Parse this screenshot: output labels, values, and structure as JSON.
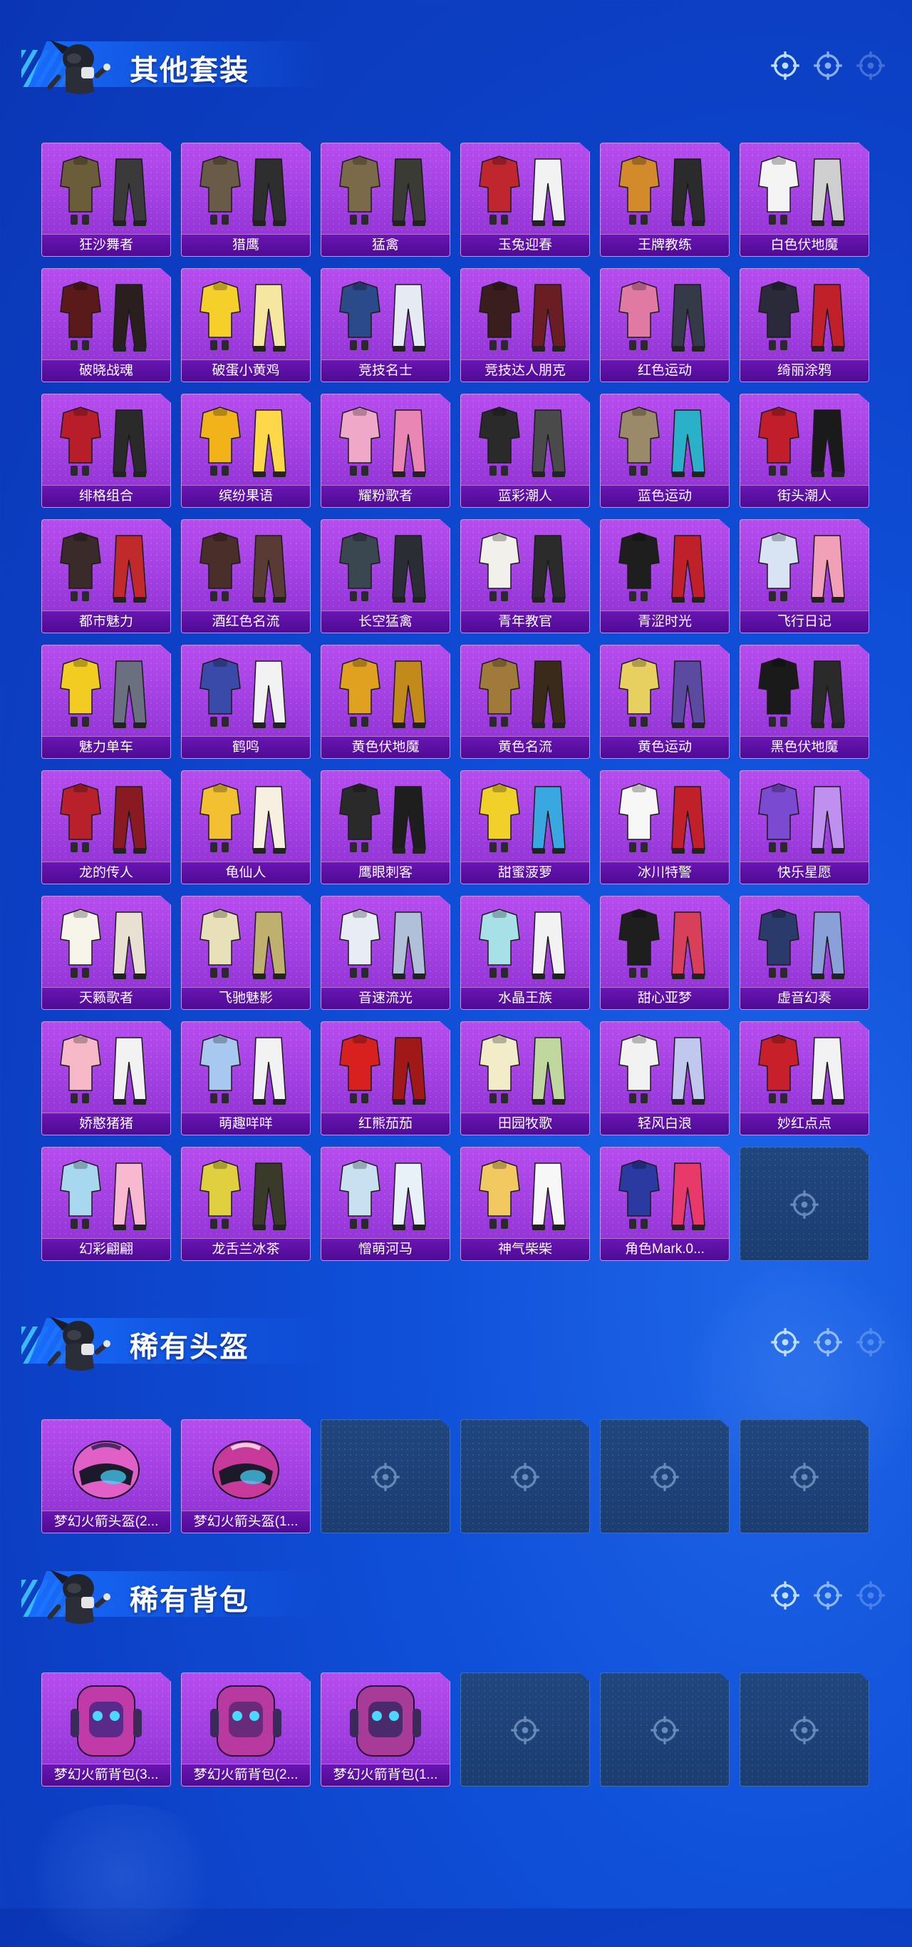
{
  "colors": {
    "page_bg": "#0c3fc4",
    "card_purple": "#a03ee0",
    "label_bar": "#5a0fa0",
    "empty_slot": "#1d4175",
    "accent_cyan": "#3fc7ff"
  },
  "sections": [
    {
      "title": "其他套装",
      "items": [
        {
          "label": "狂沙舞者"
        },
        {
          "label": "猎鹰"
        },
        {
          "label": "猛禽"
        },
        {
          "label": "玉兔迎春"
        },
        {
          "label": "王牌教练"
        },
        {
          "label": "白色伏地魔"
        },
        {
          "label": "破晓战魂"
        },
        {
          "label": "破蛋小黄鸡"
        },
        {
          "label": "竞技名士"
        },
        {
          "label": "竞技达人朋克"
        },
        {
          "label": "红色运动"
        },
        {
          "label": "绮丽涂鸦"
        },
        {
          "label": "绯格组合"
        },
        {
          "label": "缤纷果语"
        },
        {
          "label": "耀粉歌者"
        },
        {
          "label": "蓝彩潮人"
        },
        {
          "label": "蓝色运动"
        },
        {
          "label": "街头潮人"
        },
        {
          "label": "都市魅力"
        },
        {
          "label": "酒红色名流"
        },
        {
          "label": "长空猛禽"
        },
        {
          "label": "青年教官"
        },
        {
          "label": "青涩时光"
        },
        {
          "label": "飞行日记"
        },
        {
          "label": "魅力单车"
        },
        {
          "label": "鹤鸣"
        },
        {
          "label": "黄色伏地魔"
        },
        {
          "label": "黄色名流"
        },
        {
          "label": "黄色运动"
        },
        {
          "label": "黑色伏地魔"
        },
        {
          "label": "龙的传人"
        },
        {
          "label": "龟仙人"
        },
        {
          "label": "鹰眼刺客"
        },
        {
          "label": "甜蜜菠萝"
        },
        {
          "label": "冰川特警"
        },
        {
          "label": "快乐星愿"
        },
        {
          "label": "天籁歌者"
        },
        {
          "label": "飞驰魅影"
        },
        {
          "label": "音速流光"
        },
        {
          "label": "水晶王族"
        },
        {
          "label": "甜心亚梦"
        },
        {
          "label": "虚音幻奏"
        },
        {
          "label": "娇憨猪猪"
        },
        {
          "label": "萌趣咩咩"
        },
        {
          "label": "红熊茄茄"
        },
        {
          "label": "田园牧歌"
        },
        {
          "label": "轻风白浪"
        },
        {
          "label": "妙红点点"
        },
        {
          "label": "幻彩翩翩"
        },
        {
          "label": "龙舌兰冰茶"
        },
        {
          "label": "憎萌河马"
        },
        {
          "label": "神气柴柴"
        },
        {
          "label": "角色Mark.0..."
        },
        {
          "label": "",
          "empty": true
        }
      ]
    },
    {
      "title": "稀有头盔",
      "items": [
        {
          "label": "梦幻火箭头盔(2..."
        },
        {
          "label": "梦幻火箭头盔(1..."
        },
        {
          "label": "",
          "empty": true
        },
        {
          "label": "",
          "empty": true
        },
        {
          "label": "",
          "empty": true
        },
        {
          "label": "",
          "empty": true
        }
      ]
    },
    {
      "title": "稀有背包",
      "items": [
        {
          "label": "梦幻火箭背包(3..."
        },
        {
          "label": "梦幻火箭背包(2..."
        },
        {
          "label": "梦幻火箭背包(1..."
        },
        {
          "label": "",
          "empty": true
        },
        {
          "label": "",
          "empty": true
        },
        {
          "label": "",
          "empty": true
        }
      ]
    }
  ]
}
